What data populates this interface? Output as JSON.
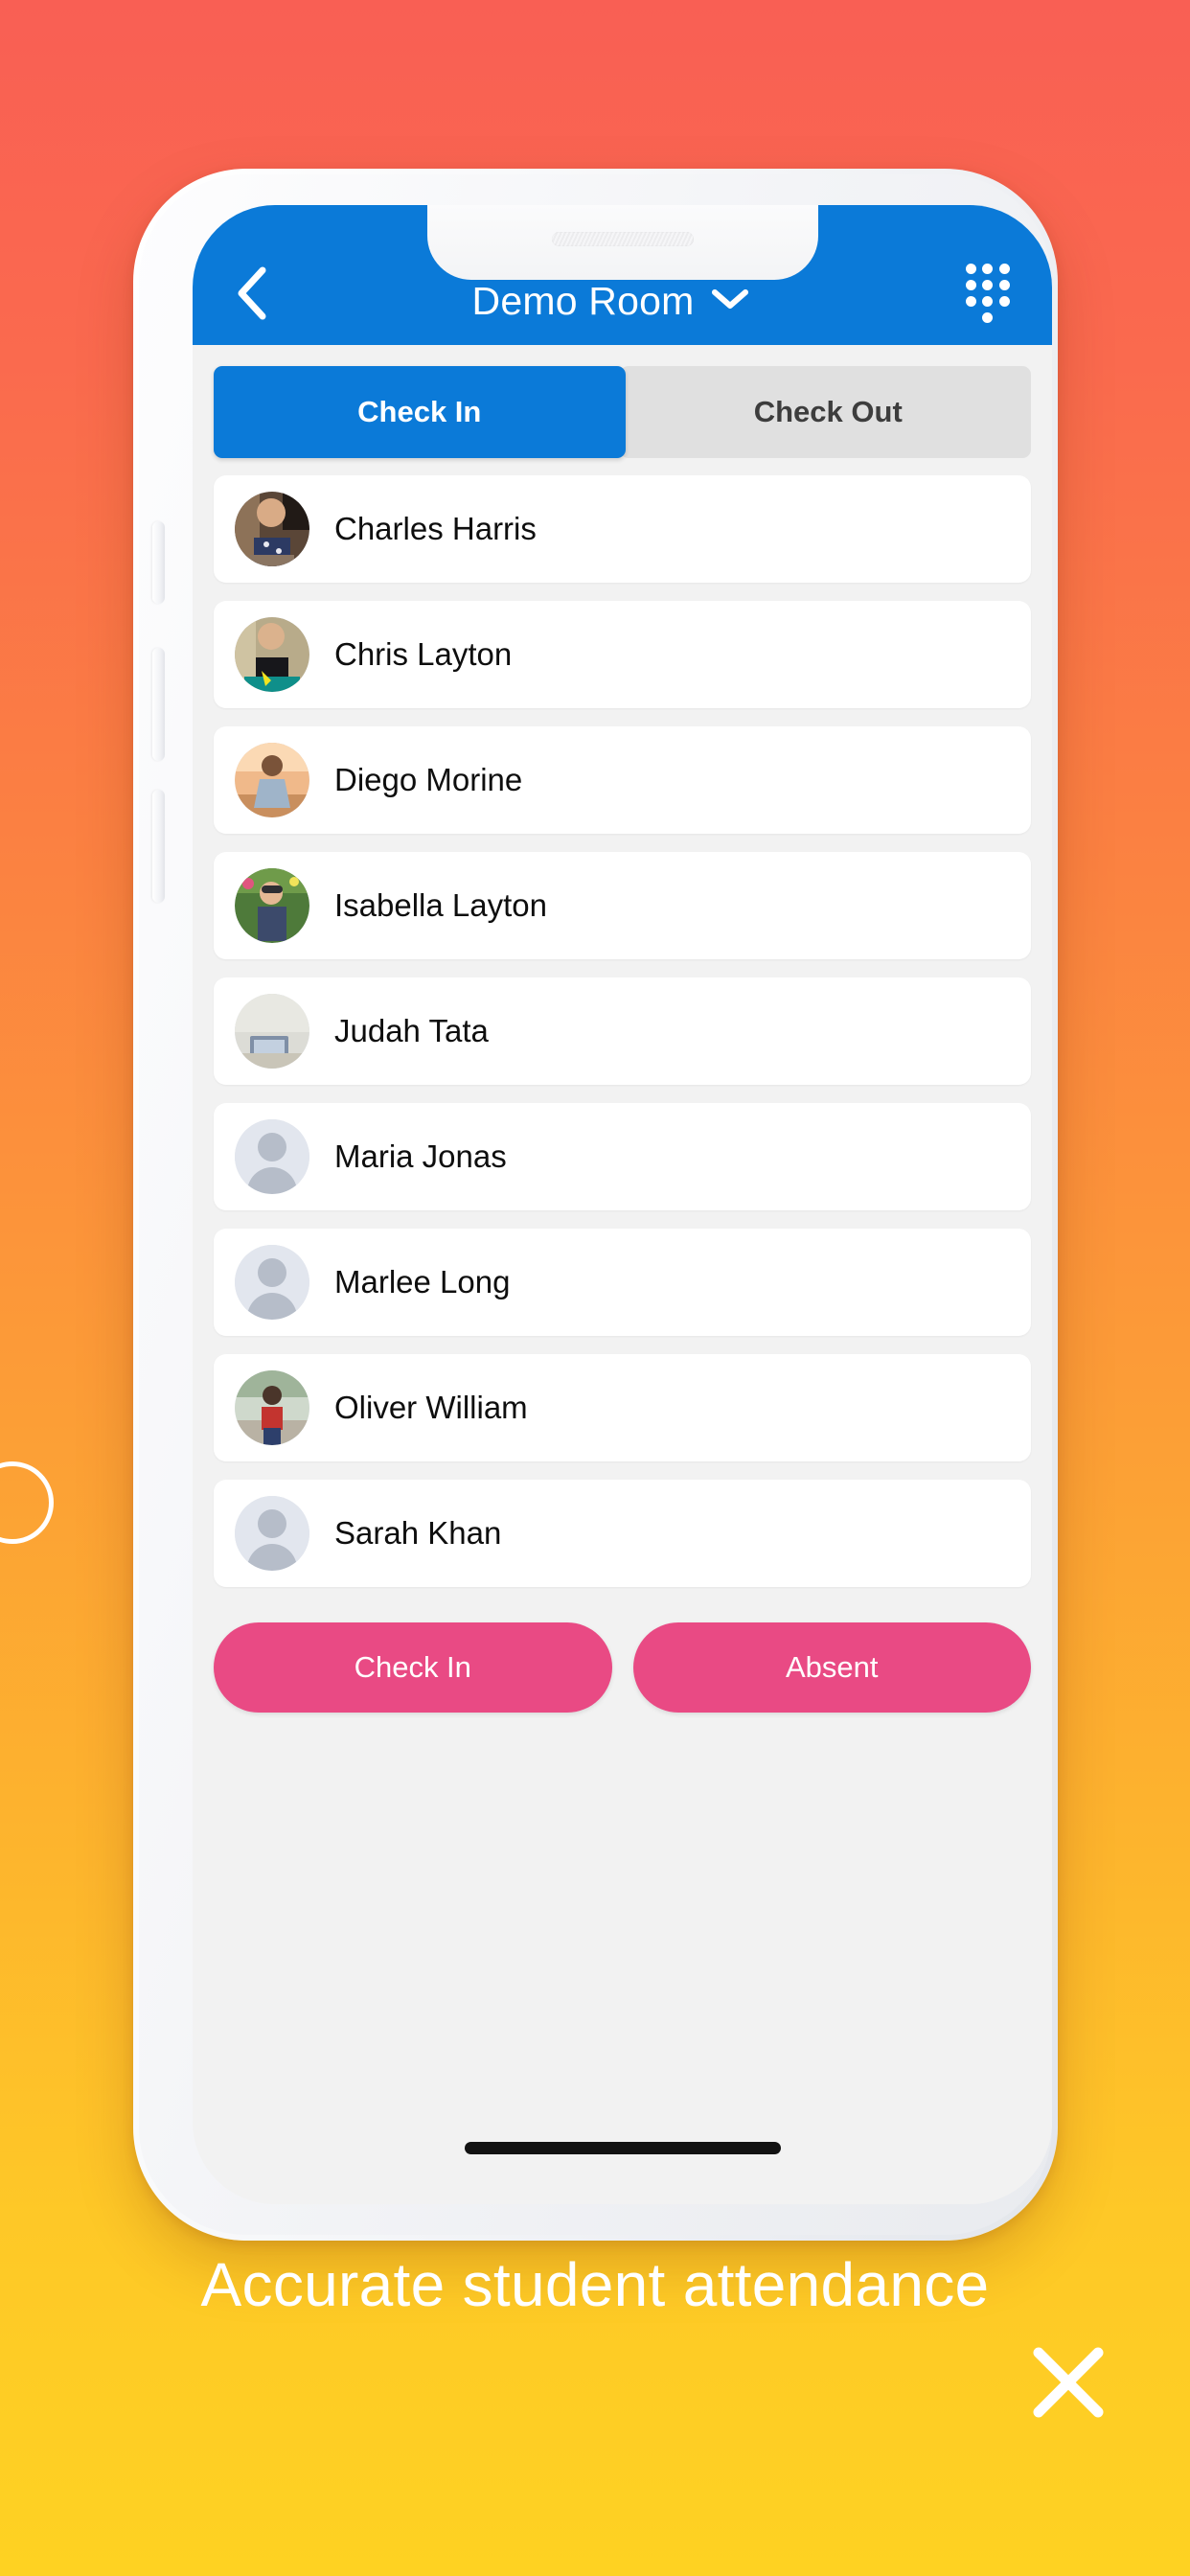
{
  "ad": {
    "caption": "Accurate student attendance",
    "close_icon": "close-x-icon",
    "background_colors": [
      "#f95f54",
      "#fdb52d",
      "#fed222"
    ],
    "accent_blue": "#0b7ad8",
    "accent_pink": "#e94a84"
  },
  "decor": {
    "ring_icon": "circle-outline-decoration"
  },
  "phone": {
    "speaker_icon": "earpiece-speaker",
    "home_indicator": "home-indicator-bar",
    "buttons": {
      "mute": "mute-switch",
      "volume_up": "volume-up-button",
      "volume_down": "volume-down-button",
      "power": "power-button"
    }
  },
  "app": {
    "navbar": {
      "back_icon": "back-chevron-icon",
      "title": "Demo Room",
      "title_dropdown_icon": "chevron-down-icon",
      "grid_icon": "keypad-grid-icon"
    },
    "tabs": [
      {
        "label": "Check In",
        "active": true
      },
      {
        "label": "Check Out",
        "active": false
      }
    ],
    "students": [
      {
        "name": "Charles Harris",
        "avatar": "photo"
      },
      {
        "name": "Chris Layton",
        "avatar": "photo"
      },
      {
        "name": "Diego Morine",
        "avatar": "photo"
      },
      {
        "name": "Isabella Layton",
        "avatar": "photo"
      },
      {
        "name": "Judah Tata",
        "avatar": "photo"
      },
      {
        "name": "Maria Jonas",
        "avatar": "placeholder"
      },
      {
        "name": "Marlee Long",
        "avatar": "placeholder"
      },
      {
        "name": "Oliver William",
        "avatar": "photo"
      },
      {
        "name": "Sarah Khan",
        "avatar": "placeholder"
      }
    ],
    "actions": [
      {
        "label": "Check In"
      },
      {
        "label": "Absent"
      }
    ]
  }
}
